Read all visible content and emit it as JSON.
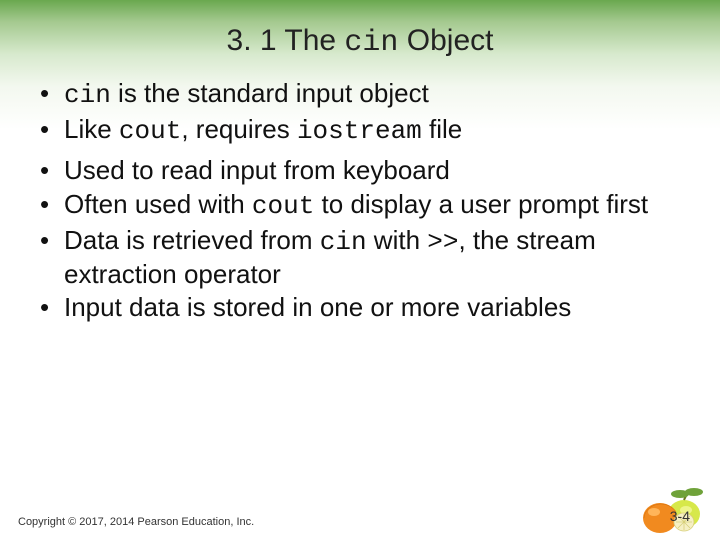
{
  "title": {
    "pre": "3. 1 The ",
    "code": "cin",
    "post": " Object"
  },
  "bullets": {
    "b1": {
      "code1": "cin",
      "t1": " is the standard input object"
    },
    "b2": {
      "t1": "Like ",
      "code1": "cout",
      "t2": ", requires ",
      "code2": "iostream",
      "t3": " file"
    },
    "b3": {
      "t1": "Used to read input from keyboard"
    },
    "b4": {
      "t1": "Often used with ",
      "code1": "cout",
      "t2": " to display a user prompt first"
    },
    "b5": {
      "t1": "Data is retrieved from ",
      "code1": "cin",
      "t2": " with ",
      "code2": ">>",
      "t3": ", the stream extraction operator"
    },
    "b6": {
      "t1": "Input data is stored in one or more variables"
    }
  },
  "footer": "Copyright © 2017, 2014 Pearson Education, Inc.",
  "pagenum": "3-4"
}
